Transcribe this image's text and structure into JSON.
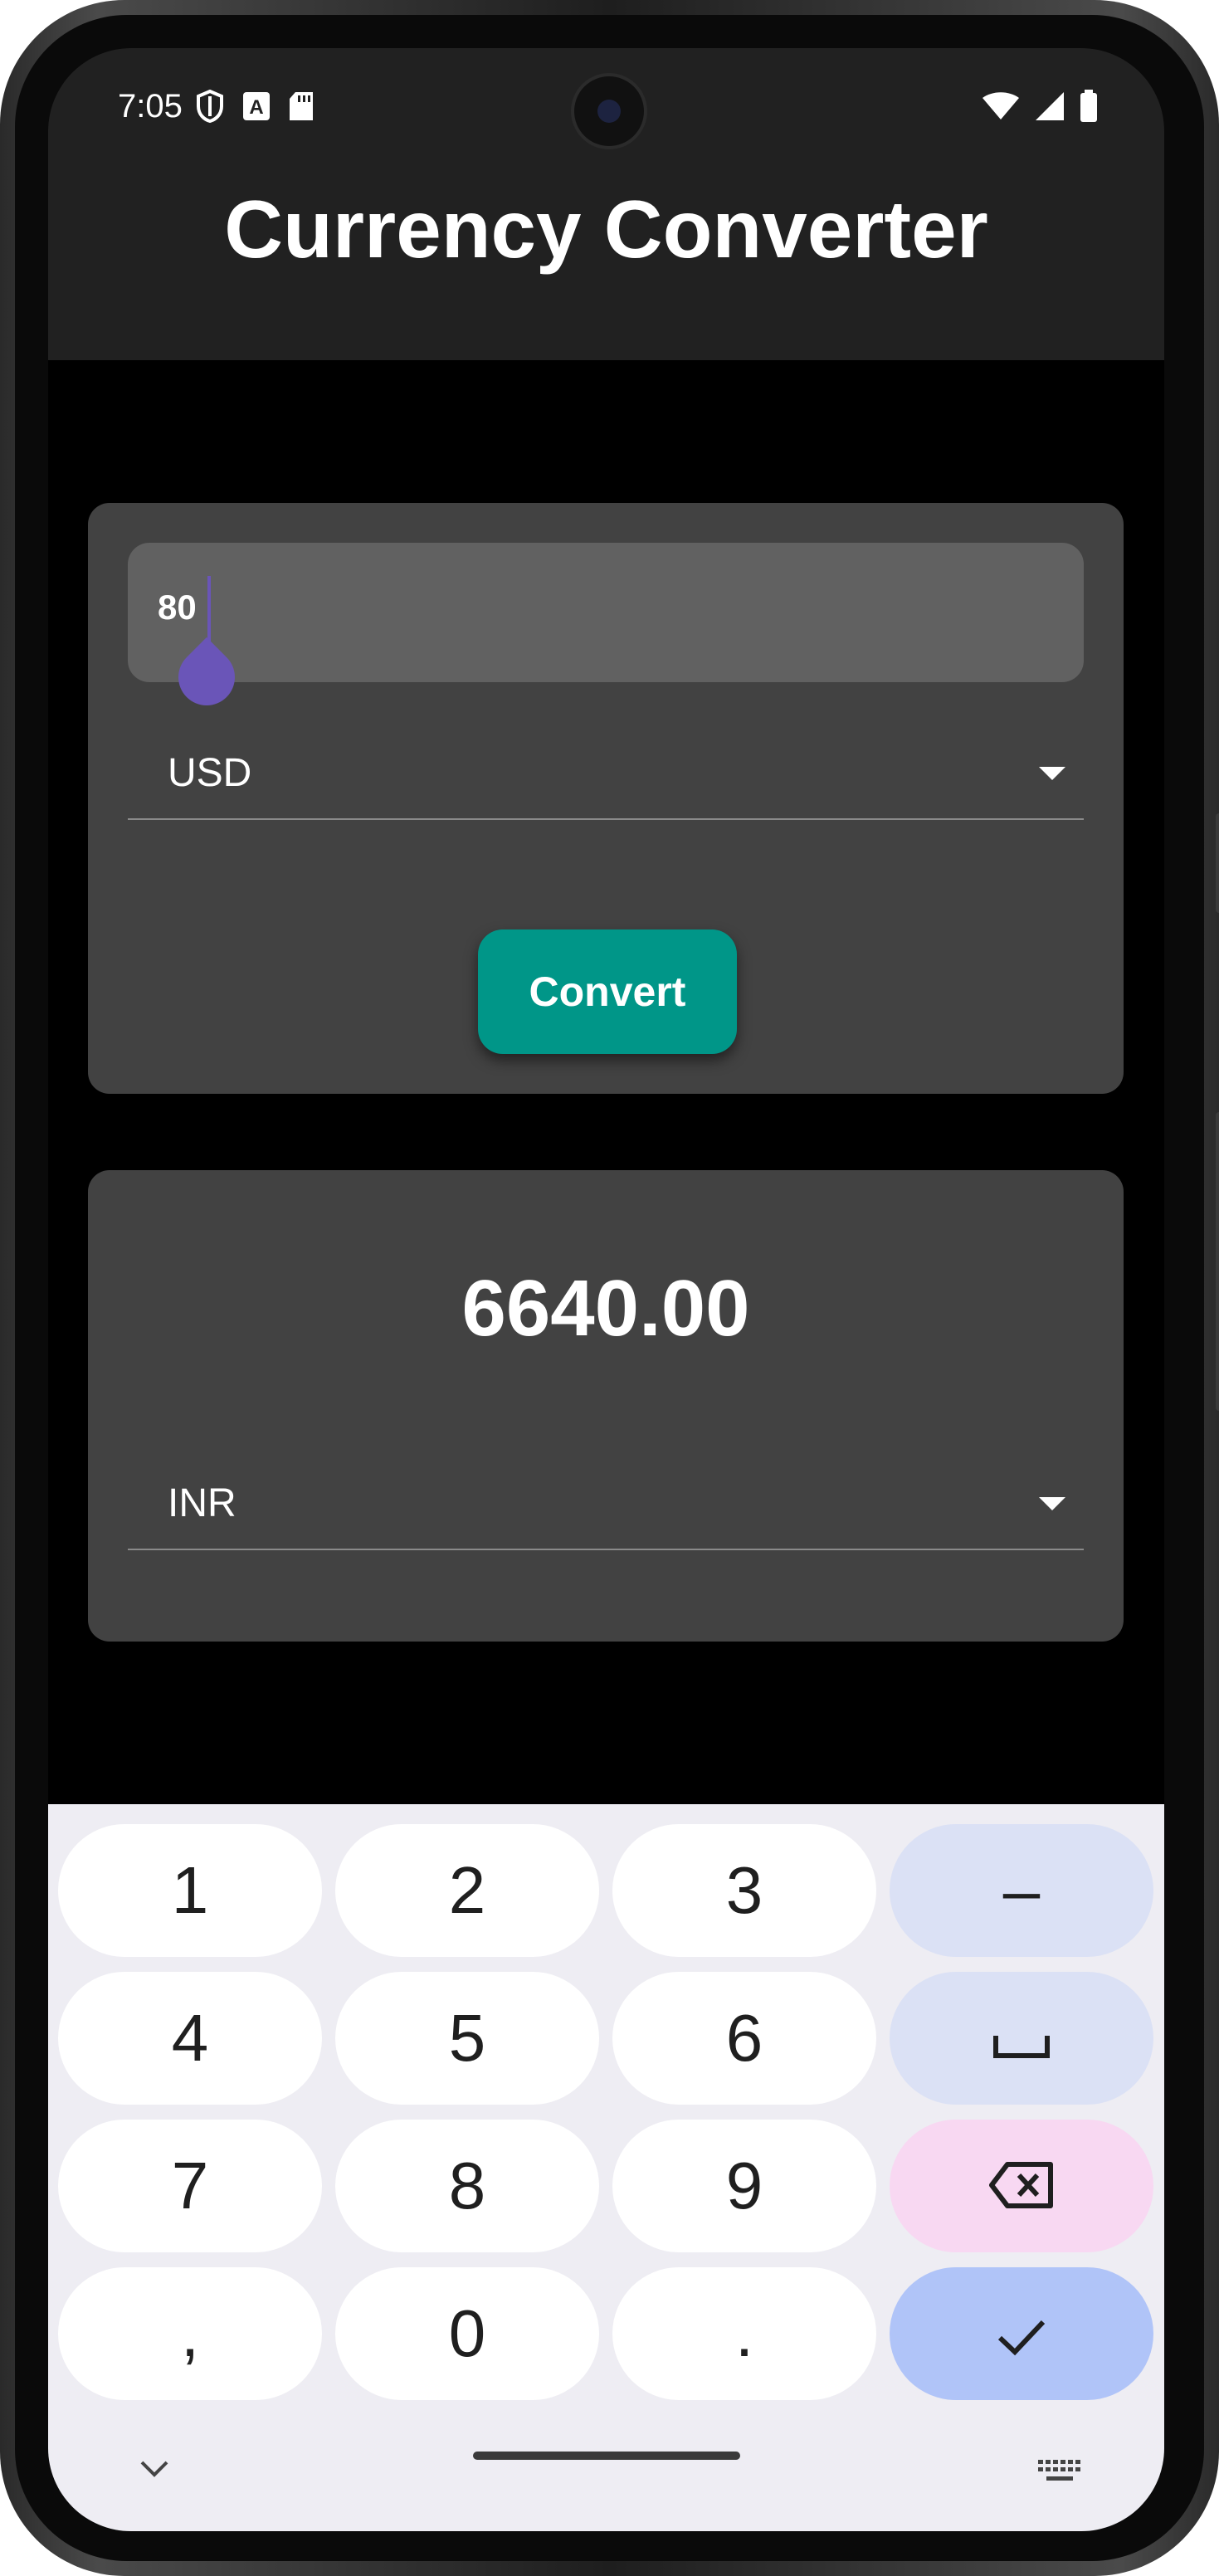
{
  "status_bar": {
    "time": "7:05"
  },
  "app_bar": {
    "title": "Currency Converter"
  },
  "converter": {
    "amount_value": "80",
    "from_currency": "USD",
    "convert_label": "Convert"
  },
  "result": {
    "value": "6640.00",
    "to_currency": "INR"
  },
  "keyboard": {
    "row1": [
      "1",
      "2",
      "3",
      "–"
    ],
    "row2": [
      "4",
      "5",
      "6"
    ],
    "row3": [
      "7",
      "8",
      "9"
    ],
    "row4": [
      ",",
      "0",
      "."
    ]
  },
  "colors": {
    "accent_purple": "#6a55b8",
    "convert_button": "#009688",
    "card_bg": "#424242",
    "app_bar_bg": "#212121"
  }
}
